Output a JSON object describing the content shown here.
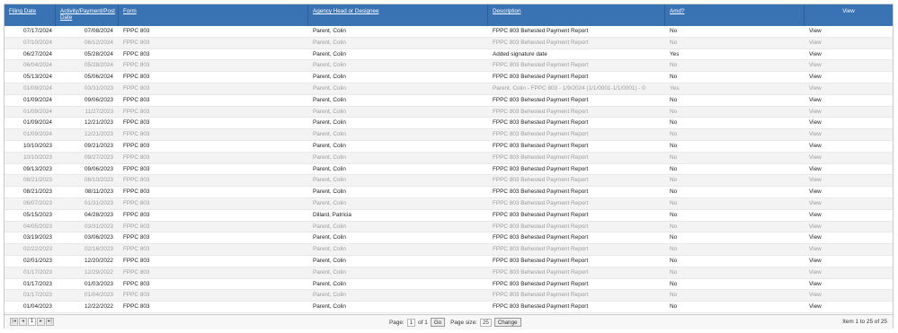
{
  "columns": [
    "Filing Date",
    "Activity/Payment/Post Date",
    "Form",
    "Agency Head or Designee",
    "Description",
    "Amd?",
    "View"
  ],
  "rows": [
    [
      "07/17/2024",
      "07/08/2024",
      "FPPC 803",
      "Parent, Colin",
      "FPPC 803 Behested Payment Report",
      "No",
      "View"
    ],
    [
      "07/10/2024",
      "06/12/2024",
      "FPPC 803",
      "Parent, Colin",
      "FPPC 803 Behested Payment Report",
      "No",
      "View"
    ],
    [
      "06/27/2024",
      "05/28/2024",
      "FPPC 803",
      "Parent, Colin",
      "Added signature date",
      "Yes",
      "View"
    ],
    [
      "06/04/2024",
      "05/28/2024",
      "FPPC 803",
      "Parent, Colin",
      "FPPC 803 Behested Payment Report",
      "No",
      "View"
    ],
    [
      "05/13/2024",
      "05/06/2024",
      "FPPC 803",
      "Parent, Colin",
      "FPPC 803 Behested Payment Report",
      "No",
      "View"
    ],
    [
      "01/09/2024",
      "03/31/2023",
      "FPPC 803",
      "Parent, Colin",
      "Parent, Colin - FPPC 803 - 1/9/2024 (1/1/0001-1/1/0001) - 0",
      "Yes",
      "View"
    ],
    [
      "01/09/2024",
      "09/06/2023",
      "FPPC 803",
      "Parent, Colin",
      "FPPC 803 Behested Payment Report",
      "No",
      "View"
    ],
    [
      "01/09/2024",
      "11/27/2023",
      "FPPC 803",
      "Parent, Colin",
      "FPPC 803 Behested Payment Report",
      "No",
      "View"
    ],
    [
      "01/09/2024",
      "12/21/2023",
      "FPPC 803",
      "Parent, Colin",
      "FPPC 803 Behested Payment Report",
      "No",
      "View"
    ],
    [
      "01/09/2024",
      "12/21/2023",
      "FPPC 803",
      "Parent, Colin",
      "FPPC 803 Behested Payment Report",
      "No",
      "View"
    ],
    [
      "10/10/2023",
      "09/21/2023",
      "FPPC 803",
      "Parent, Colin",
      "FPPC 803 Behested Payment Report",
      "No",
      "View"
    ],
    [
      "10/10/2023",
      "09/27/2023",
      "FPPC 803",
      "Parent, Colin",
      "FPPC 803 Behested Payment Report",
      "No",
      "View"
    ],
    [
      "09/13/2023",
      "09/06/2023",
      "FPPC 803",
      "Parent, Colin",
      "FPPC 803 Behested Payment Report",
      "No",
      "View"
    ],
    [
      "08/21/2023",
      "08/10/2023",
      "FPPC 803",
      "Parent, Colin",
      "FPPC 803 Behested Payment Report",
      "No",
      "View"
    ],
    [
      "08/21/2023",
      "08/11/2023",
      "FPPC 803",
      "Parent, Colin",
      "FPPC 803 Behested Payment Report",
      "No",
      "View"
    ],
    [
      "06/07/2023",
      "01/31/2023",
      "FPPC 803",
      "Parent, Colin",
      "FPPC 803 Behested Payment Report",
      "No",
      "View"
    ],
    [
      "05/15/2023",
      "04/28/2023",
      "FPPC 803",
      "Dillard, Patricia",
      "FPPC 803 Behested Payment Report",
      "No",
      "View"
    ],
    [
      "04/05/2023",
      "03/31/2023",
      "FPPC 803",
      "Parent, Colin",
      "FPPC 803 Behested Payment Report",
      "No",
      "View"
    ],
    [
      "03/19/2023",
      "03/06/2023",
      "FPPC 803",
      "Parent, Colin",
      "FPPC 803 Behested Payment Report",
      "No",
      "View"
    ],
    [
      "02/22/2023",
      "02/16/2023",
      "FPPC 803",
      "Parent, Colin",
      "FPPC 803 Behested Payment Report",
      "No",
      "View"
    ],
    [
      "02/01/2023",
      "12/20/2022",
      "FPPC 803",
      "Parent, Colin",
      "FPPC 803 Behested Payment Report",
      "No",
      "View"
    ],
    [
      "01/17/2023",
      "12/29/2022",
      "FPPC 803",
      "Parent, Colin",
      "FPPC 803 Behested Payment Report",
      "No",
      "View"
    ],
    [
      "01/17/2023",
      "01/03/2023",
      "FPPC 803",
      "Parent, Colin",
      "FPPC 803 Behested Payment Report",
      "No",
      "View"
    ],
    [
      "01/17/2023",
      "01/04/2023",
      "FPPC 803",
      "Parent, Colin",
      "FPPC 803 Behested Payment Report",
      "No",
      "View"
    ],
    [
      "01/04/2023",
      "12/22/2022",
      "FPPC 803",
      "Parent, Colin",
      "FPPC 803 Behested Payment Report",
      "No",
      "View"
    ]
  ],
  "pager": {
    "first": "|◂",
    "prev": "◂",
    "current_page": "1",
    "next": "▸",
    "last": "▸|",
    "page_label": "Page:",
    "page_value": "1",
    "of_label": "of 1",
    "go_label": "Go",
    "size_label": "Page size:",
    "size_value": "25",
    "change_label": "Change",
    "items_text": "Item 1 to 25 of 25"
  }
}
